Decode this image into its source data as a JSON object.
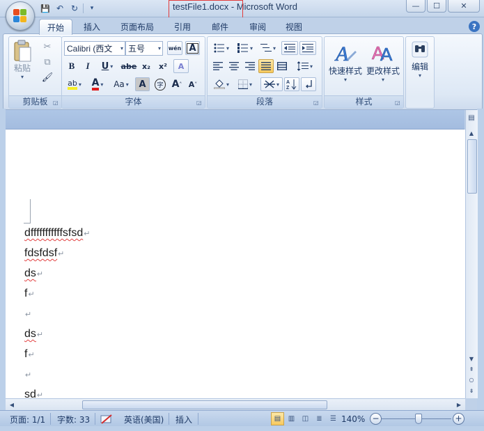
{
  "window": {
    "title_file": "testFile1.docx",
    "title_sep": " - ",
    "title_app": "Microsoft Word",
    "controls": {
      "minimize": "—",
      "maximize": "☐",
      "close": "✕"
    }
  },
  "qat": {
    "save": "💾",
    "undo": "↶",
    "redo": "↻",
    "customize": "▾"
  },
  "tabs": [
    {
      "label": "开始"
    },
    {
      "label": "插入"
    },
    {
      "label": "页面布局"
    },
    {
      "label": "引用"
    },
    {
      "label": "邮件"
    },
    {
      "label": "审阅"
    },
    {
      "label": "视图"
    }
  ],
  "help": "?",
  "ribbon": {
    "clipboard": {
      "label": "剪贴板",
      "paste": "粘贴",
      "cut": "✂",
      "copy": "⧉",
      "format_painter": "🖌"
    },
    "font": {
      "label": "字体",
      "font_name": "Calibri (西文",
      "font_size": "五号",
      "phonetic": "wén",
      "char_border": "A",
      "bold": "B",
      "italic": "I",
      "underline": "U",
      "strike": "abe",
      "subscript": "x₂",
      "superscript": "x²",
      "clear_format": "A",
      "highlight": "ab",
      "font_color": "A",
      "change_case": "Aa",
      "char_shading": "A",
      "enclosed": "字",
      "grow": "A",
      "shrink": "A"
    },
    "paragraph": {
      "label": "段落"
    },
    "styles": {
      "label": "样式",
      "quick_styles": "快速样式",
      "change_styles": "更改样式"
    },
    "editing": {
      "label": "编辑"
    }
  },
  "document": {
    "lines": [
      {
        "text": "dfffffffffffsfsd",
        "spell": true
      },
      {
        "text": "fdsfdsf",
        "spell": true
      },
      {
        "text": "ds",
        "spell": true
      },
      {
        "text": "f",
        "spell": false
      },
      {
        "text": "",
        "spell": false
      },
      {
        "text": "ds",
        "spell": true
      },
      {
        "text": "f",
        "spell": false
      },
      {
        "text": "",
        "spell": false
      },
      {
        "text": "sd",
        "spell": true
      }
    ],
    "paragraph_mark": "↵"
  },
  "status": {
    "page": "页面: 1/1",
    "words": "字数: 33",
    "language": "英语(美国)",
    "mode": "插入",
    "zoom": "140%",
    "zoom_minus": "−",
    "zoom_plus": "+"
  }
}
